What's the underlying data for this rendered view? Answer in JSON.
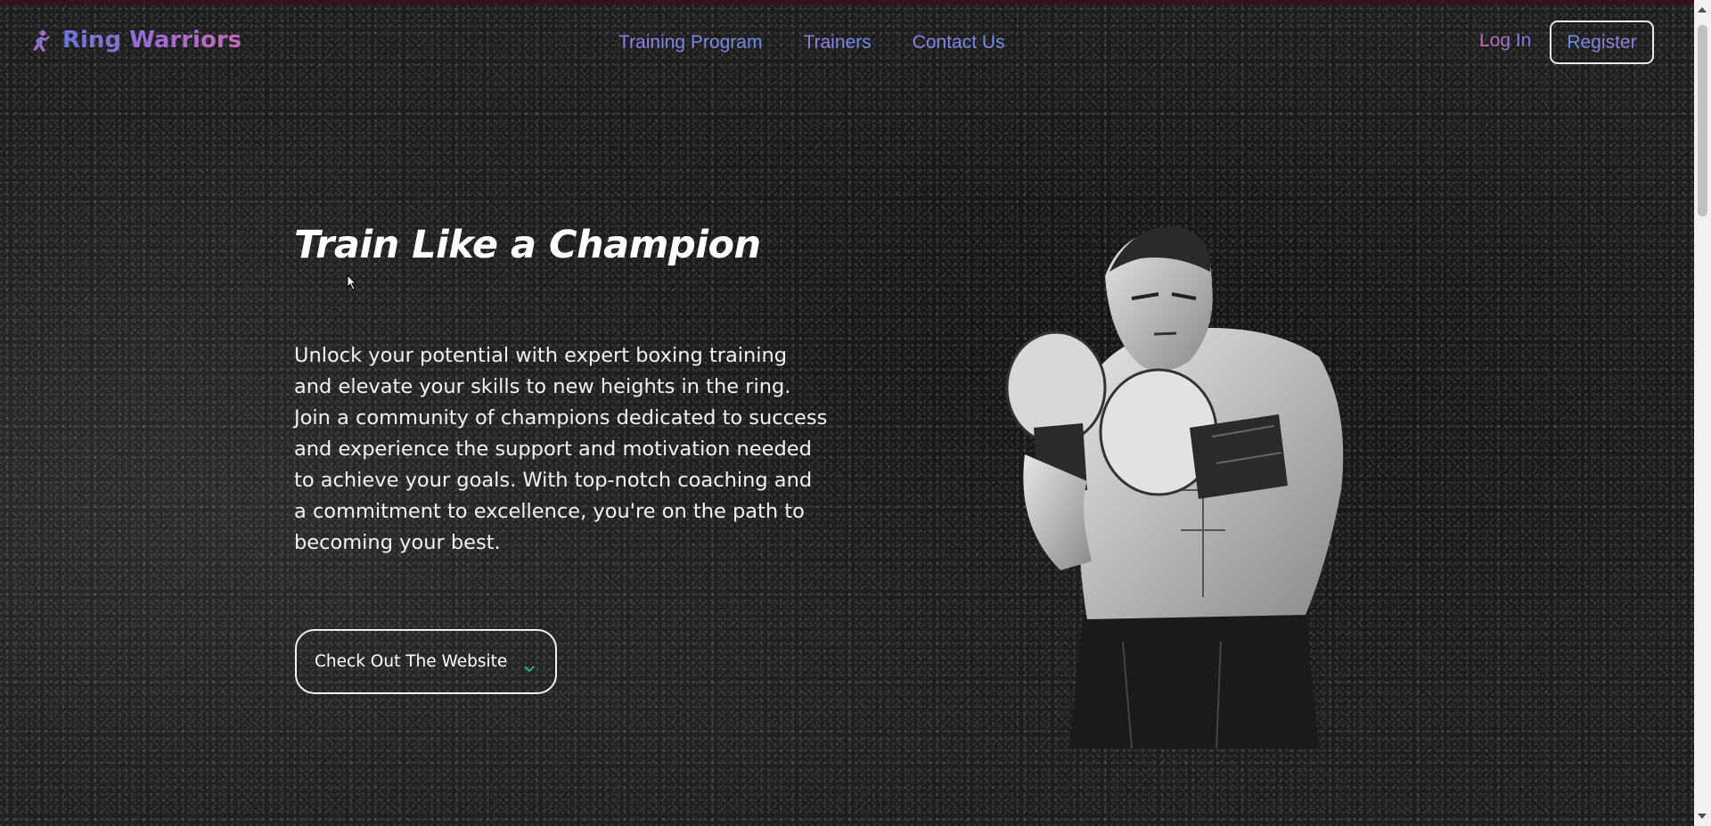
{
  "header": {
    "logo_text": "Ring Warriors",
    "logo_icon": "boxing-fighter-icon",
    "nav": [
      {
        "label": "Training Program"
      },
      {
        "label": "Trainers"
      },
      {
        "label": "Contact Us"
      }
    ],
    "login_label": "Log In",
    "register_label": "Register"
  },
  "hero": {
    "title": "Train Like a Champion",
    "description": "Unlock your potential with expert boxing training and elevate your skills to new heights in the ring. Join a community of champions dedicated to success and experience the support and motivation needed to achieve your goals. With top-notch coaching and a commitment to excellence, you're on the path to becoming your best.",
    "cta_label": "Check Out The Website",
    "cta_icon": "chevron-down-icon",
    "image": "boxer-illustration"
  },
  "colors": {
    "background": "#1e1e1e",
    "accent_blue": "#6d8fe6",
    "accent_pink": "#c96ab0",
    "accent_purple": "#9b7be0"
  }
}
